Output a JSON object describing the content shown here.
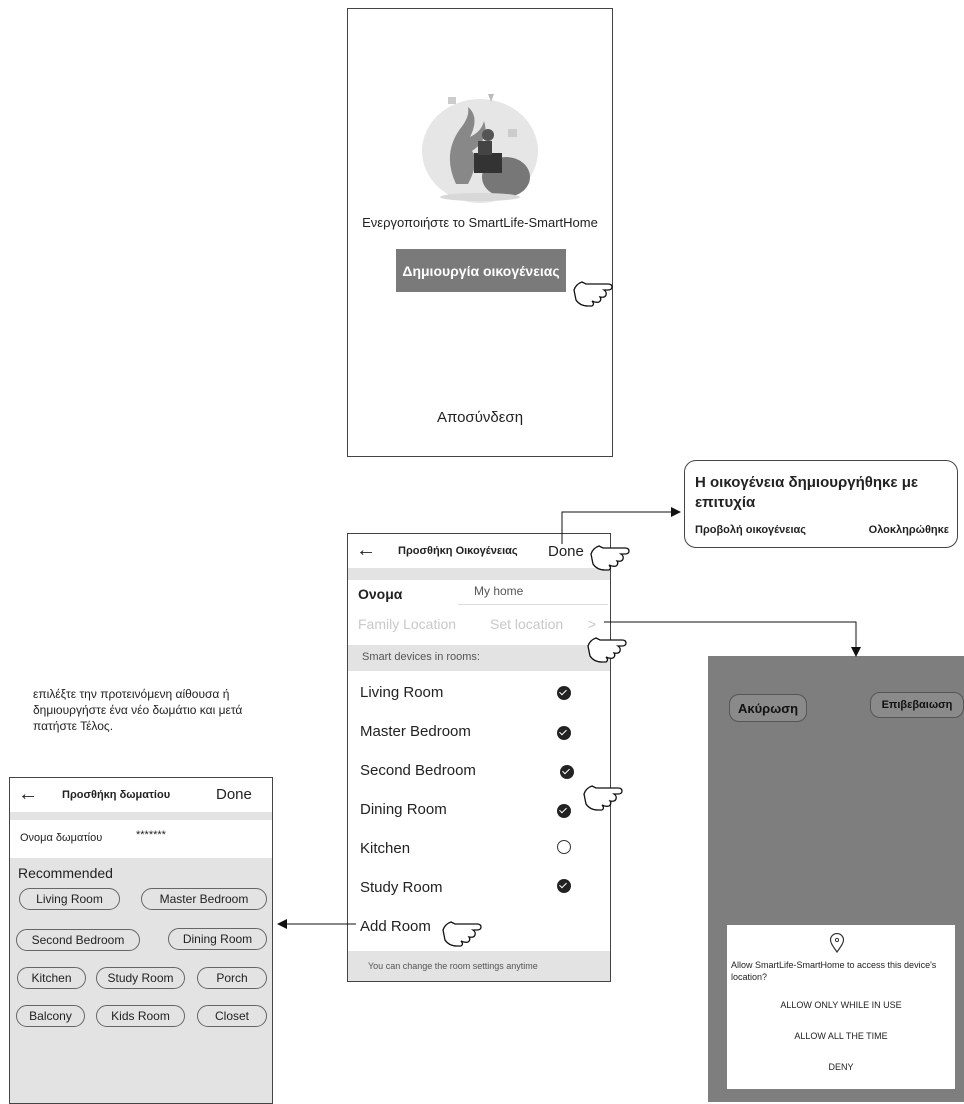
{
  "screen_setup": {
    "activate_text": "Ενεργοποιήστε το SmartLife-SmartHome",
    "create_family_button": "Δημιουργία οικογένειας",
    "logout_link": "Αποσύνδεση"
  },
  "success_popup": {
    "title": "Η οικογένεια δημιουργήθηκε με επιτυχία",
    "view_family": "Προβολή οικογένειας",
    "completed": "Ολοκληρώθηκε"
  },
  "add_family": {
    "back_icon": "arrow-left-icon",
    "title": "Προσθήκη Οικογένειας",
    "done": "Done",
    "name_label": "Ονομα",
    "name_value": "My home",
    "location_label": "Family Location",
    "location_value": "Set location",
    "location_arrow": ">",
    "rooms_header": "Smart devices in rooms:",
    "rooms": [
      {
        "label": "Living Room",
        "checked": true
      },
      {
        "label": "Master Bedroom",
        "checked": true
      },
      {
        "label": "Second Bedroom",
        "checked": true
      },
      {
        "label": "Dining Room",
        "checked": true
      },
      {
        "label": "Kitchen",
        "checked": false
      },
      {
        "label": "Study Room",
        "checked": true
      }
    ],
    "add_room": "Add Room",
    "footer_note": "You can change the room settings anytime"
  },
  "location_screen": {
    "cancel": "Ακύρωση",
    "confirm": "Επιβεβαιωση",
    "pin_icon": "location-pin-icon",
    "question": "Allow SmartLife-SmartHome to access this device's location?",
    "option_while_in_use": "ALLOW  ONLY WHILE IN USE",
    "option_all_time": "ALLOW  ALL THE TIME",
    "option_deny": "DENY"
  },
  "instructions": {
    "text": "επιλέξτε την προτεινόμενη αίθουσα ή δημιουργήστε ένα νέο δωμάτιο και μετά πατήστε Τέλος."
  },
  "add_room": {
    "back_icon": "arrow-left-icon",
    "title": "Προσθήκη δωματίου",
    "done": "Done",
    "name_label": "Ονομα δωματίου",
    "name_value": "*******",
    "recommended_label": "Recommended",
    "chips": [
      "Living Room",
      "Master Bedroom",
      "Second Bedroom",
      "Dining Room",
      "Kitchen",
      "Study Room",
      "Porch",
      "Balcony",
      "Kids Room",
      "Closet"
    ]
  },
  "colors": {
    "button_gray": "#7a7a7a",
    "band_gray": "#e3e3e3",
    "location_bg": "#7e7e7e"
  }
}
